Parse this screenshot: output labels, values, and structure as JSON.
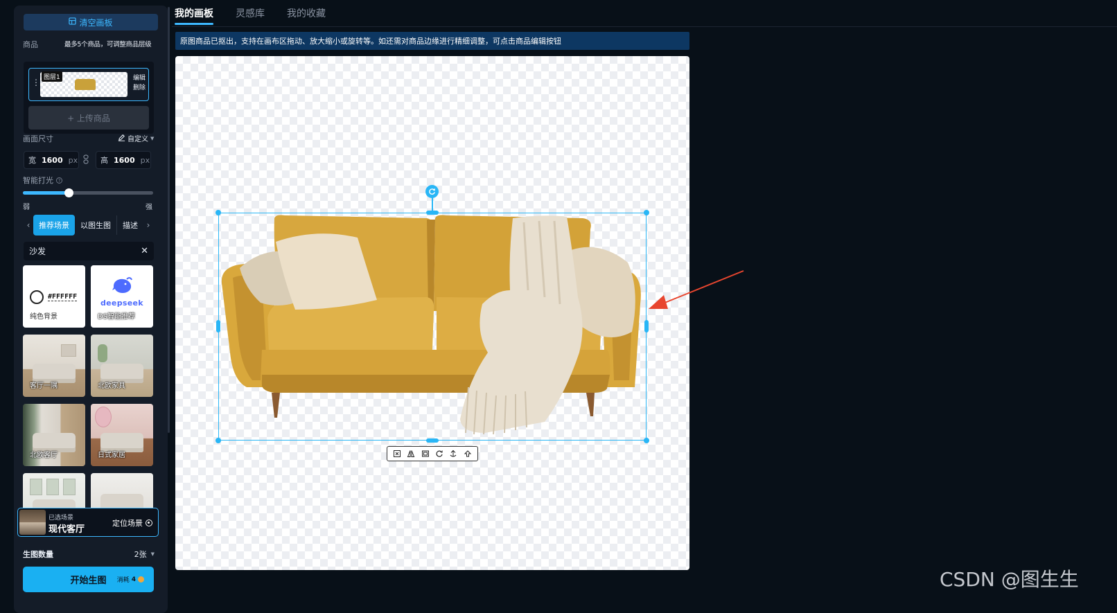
{
  "top_tabs": [
    {
      "label": "我的画板",
      "active": true
    },
    {
      "label": "灵感库",
      "active": false
    },
    {
      "label": "我的收藏",
      "active": false
    }
  ],
  "notice": "原图商品已抠出，支持在画布区拖动、放大缩小或旋转等。如还需对商品边缘进行精细调整，可点击商品编辑按钮",
  "sidebar": {
    "clear_button": "清空画板",
    "product_label": "商品",
    "product_hint": "最多5个商品，可调整商品层级",
    "layer": {
      "tag": "图层1",
      "edit": "编辑",
      "delete": "删除"
    },
    "upload_button": "+ 上传商品",
    "size_label": "画面尺寸",
    "size_mode": "自定义",
    "width": {
      "label": "宽",
      "value": "1600",
      "unit": "px"
    },
    "height": {
      "label": "高",
      "value": "1600",
      "unit": "px"
    },
    "lighting_label": "智能打光",
    "lighting_level": 0.35,
    "weak": "弱",
    "strong": "强",
    "scene_tabs": [
      "推荐场景",
      "以图生图",
      "描述"
    ],
    "search_value": "沙发",
    "scenes": [
      {
        "label": "纯色背景",
        "hex": "#FFFFFF"
      },
      {
        "label": "DS智能推荐",
        "logo": "deepseek"
      },
      {
        "label": "客厅一隅"
      },
      {
        "label": "北欧家具"
      },
      {
        "label": "北欧客厅"
      },
      {
        "label": "日式家居"
      },
      {
        "label": ""
      },
      {
        "label": ""
      }
    ],
    "selected_scene": {
      "caption": "已选场景",
      "name": "现代客厅",
      "locate": "定位场景"
    },
    "count_label": "生图数量",
    "count_value": "2张",
    "start_button": "开始生图",
    "cost_label": "消耗",
    "cost_value": "4"
  },
  "watermark": "CSDN @图生生",
  "colors": {
    "accent": "#3db8ff",
    "selection": "#29b6f6",
    "annotation_arrow": "#e8462f",
    "sofa": "#d9a83a"
  },
  "icons": [
    "layout-icon",
    "pen-icon",
    "link-icon",
    "help-icon",
    "close-icon",
    "chevron-left-icon",
    "chevron-right-icon",
    "rotate-icon",
    "target-icon",
    "coin-icon"
  ]
}
